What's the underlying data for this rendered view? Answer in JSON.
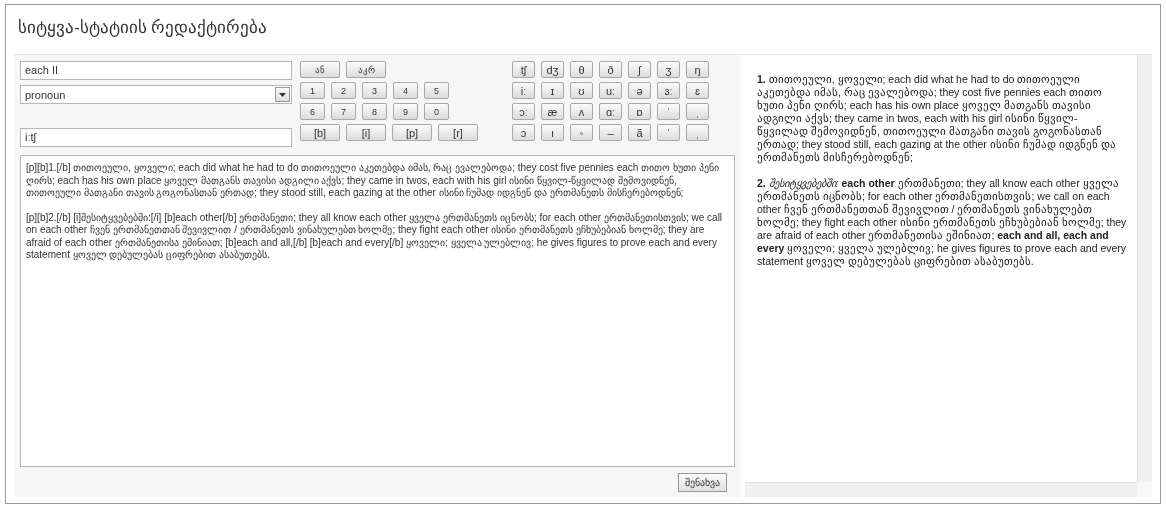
{
  "title": "სიტყვა-სტატიის რედაქტირება",
  "word_field": {
    "value": "each II"
  },
  "part_of_speech": {
    "value": "pronoun"
  },
  "transcription_field": {
    "value": "iːtʃ"
  },
  "action_buttons": [
    "ან",
    "აკრ"
  ],
  "digit_rows": [
    [
      "1",
      "2",
      "3",
      "4",
      "5"
    ],
    [
      "6",
      "7",
      "8",
      "9",
      "0"
    ]
  ],
  "tag_buttons": [
    "[b]",
    "[i]",
    "[p]",
    "[r]"
  ],
  "symbol_rows": [
    [
      "tʃ",
      "dʒ",
      "θ",
      "ð",
      "ʃ",
      "ʒ",
      "ŋ"
    ],
    [
      "iː",
      "ɪ",
      "ʊ",
      "uː",
      "ə",
      "ɜː",
      "ɛ"
    ],
    [
      "ɔː",
      "æ",
      "ʌ",
      "ɑː",
      "ɒ",
      "ˈ",
      "ˌ"
    ],
    [
      "ɔ",
      "ı",
      "◦",
      "–",
      "ã",
      "ˈ",
      "ˌ"
    ]
  ],
  "editor": {
    "paragraphs": [
      "[p][b]1.[/b] თითოეული, ყოველი; each did what he had to do თითოეული აკეთებდა იმას, რაც ევალებოდა; they cost five pennies each თითო ხუთი პენი ღირს; each has his own place ყოველ მათგანს თავისი ადგილი აქვს; they came in twos, each with his girl ისინი წყვილ-წყვილად შემოვიდნენ, თითოეული მათგანი თავის გოგონასთან ერთად; they stood still, each gazing at the other ისინი ჩუმად იდგნენ და ერთმანეთს მისჩერებოდნენ;",
      "[p][b]2.[/b] [i]შესიტყვებებში:[/i] [b]each other[/b] ერთმანეთი; they all know each other ყველა ერთმანეთს იცნობს; for each other ერთმანეთისთვის; we call on each other ჩვენ ერთმანეთთან შევივლით / ერთმანეთს ვინახულებთ ხოლმე; they fight each other ისინი ერთმანეთს ეჩხუბებიან ხოლმე; they are afraid of each other ერთმანეთისა ეშინიათ; [b]each and all,[/b] [b]each and every[/b] ყოველი; ყველა ულებლივ; he gives figures to prove each and every statement ყოველ დებულებას ციფრებით ასაბუთებს."
    ]
  },
  "save_button": "შენახვა",
  "preview": {
    "paragraphs": [
      "**1.** თითოეული, ყოველი; each did what he had to do თითოეული აკეთებდა იმას, რაც ევალებოდა; they cost five pennies each თითო ხუთი პენი ღირს; each has his own place ყოველ მათგანს თავისი ადგილი აქვს; they came in twos, each with his girl ისინი წყვილ-წყვილად შემოვიდნენ, თითოეული მათგანი თავის გოგონასთან ერთად; they stood still, each gazing at the other ისინი ჩუმად იდგნენ და ერთმანეთს მისჩერებოდნენ;",
      "**2.** *შესიტყვებებში:* **each other** ერთმანეთი; they all know each other ყველა ერთმანეთს იცნობს; for each other ერთმანეთისთვის; we call on each other ჩვენ ერთმანეთთან შევივლით / ერთმანეთს ვინახულებთ ხოლმე; they fight each other ისინი ერთმანეთს ეჩხუბებიან ხოლმე; they are afraid of each other ერთმანეთისა ეშინიათ; **each and all, each and every** ყოველი; ყველა ულებლივ; he gives figures to prove each and every statement ყოველ დებულებას ციფრებით ასაბუთებს."
    ]
  }
}
